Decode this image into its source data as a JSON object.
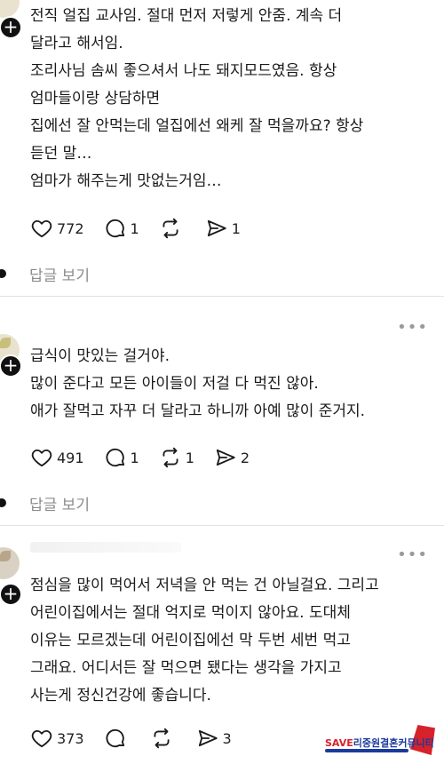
{
  "comments": [
    {
      "lines": [
        "전직 얼집 교사임. 절대 먼저 저렇게 안줌. 계속 더",
        "달라고 해서임.",
        "조리사님 솜씨 좋으셔서 나도 돼지모드였음. 항상",
        "엄마들이랑 상담하면",
        "집에선 잘 안먹는데 얼집에선 왜케 잘 먹을까요? 항상",
        "듣던 말…",
        "엄마가 해주는게 맛없는거임…"
      ],
      "likes": "772",
      "replies": "1",
      "reposts": "",
      "shares": "1",
      "view_replies": "답글 보기"
    },
    {
      "lines": [
        "급식이 맛있는 걸거야.",
        "많이 준다고 모든 아이들이 저걸 다 먹진 않아.",
        "애가 잘먹고 자꾸 더 달라고 하니까 아예 많이 준거지."
      ],
      "likes": "491",
      "replies": "1",
      "reposts": "1",
      "shares": "2",
      "view_replies": "답글 보기"
    },
    {
      "lines": [
        "점심을 많이 먹어서 저녁을 안 먹는 건 아닐걸요. 그리고",
        "어린이집에서는 절대 억지로 먹이지 않아요. 도대체",
        "이유는 모르겠는데 어린이집에선 막 두번 세번 먹고",
        "그래요. 어디서든 잘 먹으면 됐다는 생각을 가지고",
        "사는게 정신건강에 좋습니다."
      ],
      "likes": "373",
      "replies": "",
      "reposts": "",
      "shares": "3"
    }
  ],
  "more_glyph": "•••",
  "plus_glyph": "+",
  "icons": [
    "heart-icon",
    "comment-icon",
    "repost-icon",
    "share-icon",
    "more-icon",
    "add-follow-icon"
  ],
  "watermark": {
    "text_a": "SAVE",
    "text_b": "리중원결혼커뮤니티"
  },
  "colors": {
    "text": "#1a1a1a",
    "muted": "#8c8c8c",
    "divider": "#e2e2e2",
    "watermark_blue": "#1a3a9c",
    "watermark_red": "#d6222a"
  }
}
